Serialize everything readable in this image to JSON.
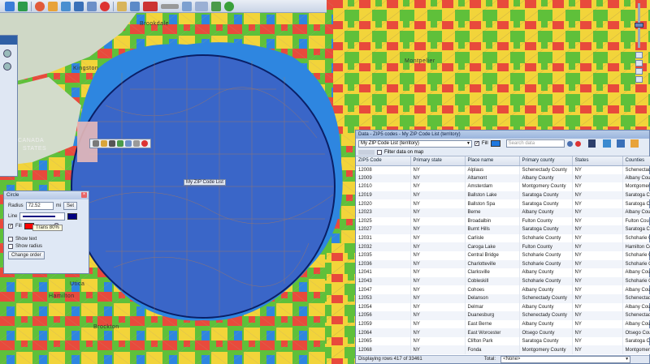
{
  "map": {
    "labels": {
      "brookdale": "Brookdale",
      "kingston": "Kingston",
      "montpelier": "Montpelier",
      "canada": "CANADA",
      "states": "STATES",
      "utica": "Utica",
      "hamilton": "Hamilton",
      "brockton": "Brockton"
    },
    "territory_label": "My ZIP Code List"
  },
  "toolbar": {
    "icons": [
      "globe-icon",
      "globe-icon",
      "target-icon",
      "network-icon",
      "layers-icon",
      "layers-icon",
      "search-icon",
      "close-icon",
      "document-icon",
      "refresh-icon",
      "flag-icon",
      "ruler-icon",
      "grid-icon",
      "pencil-icon",
      "help-icon"
    ]
  },
  "circle_dialog": {
    "title": "Circle",
    "radius_label": "Radius",
    "radius_value": "72.52",
    "radius_unit": "mi",
    "set_label": "Set",
    "line_label": "Line",
    "fill_label": "Fill",
    "transparency_tooltip": "Trans 80%",
    "show_text_label": "Show text",
    "show_radius_label": "Show radius",
    "change_order_label": "Change order",
    "fill_color": "#ff0000",
    "line_color": "#000080"
  },
  "data_panel": {
    "title": "Data - ZIP5 codes - My ZIP Code List (territory)",
    "list_select": "My ZIP Code List (territory)",
    "fill_label": "Fill",
    "search_placeholder": "Search data",
    "filter_label": "Filter data on map",
    "columns": [
      "ZIP5 Code",
      "Primary state",
      "Place name",
      "Primary county",
      "States",
      "Counties"
    ],
    "rows": [
      [
        "12008",
        "NY",
        "Alplaus",
        "Schenectady County",
        "NY",
        "Schenectady"
      ],
      [
        "12009",
        "NY",
        "Altamont",
        "Albany County",
        "NY",
        "Albany Cou"
      ],
      [
        "12010",
        "NY",
        "Amsterdam",
        "Montgomery County",
        "NY",
        "Montgomery"
      ],
      [
        "12019",
        "NY",
        "Ballston Lake",
        "Saratoga County",
        "NY",
        "Saratoga Co"
      ],
      [
        "12020",
        "NY",
        "Ballston Spa",
        "Saratoga County",
        "NY",
        "Saratoga Co"
      ],
      [
        "12023",
        "NY",
        "Berne",
        "Albany County",
        "NY",
        "Albany Cou"
      ],
      [
        "12025",
        "NY",
        "Broadalbin",
        "Fulton County",
        "NY",
        "Fulton Cou"
      ],
      [
        "12027",
        "NY",
        "Burnt Hills",
        "Saratoga County",
        "NY",
        "Saratoga Co"
      ],
      [
        "12031",
        "NY",
        "Carlisle",
        "Schoharie County",
        "NY",
        "Schoharie C"
      ],
      [
        "12032",
        "NY",
        "Caroga Lake",
        "Fulton County",
        "NY",
        "Hamilton Co"
      ],
      [
        "12035",
        "NY",
        "Central Bridge",
        "Schoharie County",
        "NY",
        "Schoharie C"
      ],
      [
        "12036",
        "NY",
        "Charlotteville",
        "Schoharie County",
        "NY",
        "Schoharie C"
      ],
      [
        "12041",
        "NY",
        "Clarksville",
        "Albany County",
        "NY",
        "Albany Cou"
      ],
      [
        "12043",
        "NY",
        "Cobleskill",
        "Schoharie County",
        "NY",
        "Schoharie C"
      ],
      [
        "12047",
        "NY",
        "Cohoes",
        "Albany County",
        "NY",
        "Albany Cou"
      ],
      [
        "12053",
        "NY",
        "Delanson",
        "Schenectady County",
        "NY",
        "Schenectady"
      ],
      [
        "12054",
        "NY",
        "Delmar",
        "Albany County",
        "NY",
        "Albany Cou"
      ],
      [
        "12056",
        "NY",
        "Duanesburg",
        "Schenectady County",
        "NY",
        "Schenectady"
      ],
      [
        "12059",
        "NY",
        "East Berne",
        "Albany County",
        "NY",
        "Albany Cou"
      ],
      [
        "12064",
        "NY",
        "East Worcester",
        "Otsego County",
        "NY",
        "Otsego Cou"
      ],
      [
        "12065",
        "NY",
        "Clifton Park",
        "Saratoga County",
        "NY",
        "Saratoga Co"
      ],
      [
        "12068",
        "NY",
        "Fonda",
        "Montgomery County",
        "NY",
        "Montgomery"
      ]
    ],
    "status": "Displaying rows 417 of 33461",
    "total_label": "Total:",
    "total_select": "<None>"
  },
  "colors": {
    "territory_fill": "#3a66c8",
    "circle_stroke": "#0a1f66",
    "zone_red": "#e84a3c",
    "zone_green": "#5fc03a",
    "zone_yellow": "#f2d43a",
    "zone_blue": "#2e86e0"
  }
}
